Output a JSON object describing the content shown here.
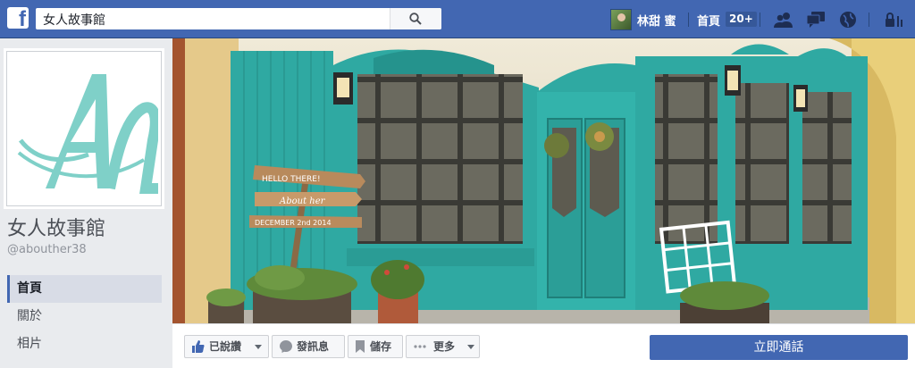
{
  "topbar": {
    "logo": "f",
    "search_value": "女人故事館",
    "user_name": "林甜 蜜",
    "home_label": "首頁",
    "home_count": "20+",
    "icons": [
      "friends-icon",
      "messages-icon",
      "notifications-globe-icon",
      "privacy-lock-icon"
    ]
  },
  "page": {
    "name": "女人故事館",
    "handle": "@abouther38",
    "profile_letter": "A",
    "cover_sign_lines": [
      "HELLO THERE!",
      "About her",
      "DECEMBER 2nd 2014"
    ],
    "storefront_arch_text": "About her"
  },
  "nav": {
    "items": [
      {
        "label": "首頁",
        "active": true
      },
      {
        "label": "關於",
        "active": false
      },
      {
        "label": "相片",
        "active": false
      }
    ]
  },
  "actions": {
    "liked": "已說讚",
    "message": "發訊息",
    "save": "儲存",
    "more": "更多",
    "call": "立即通話"
  },
  "colors": {
    "brand": "#4267b2",
    "teal": "#2fa9a2",
    "logo_teal": "#7fd0c8"
  }
}
